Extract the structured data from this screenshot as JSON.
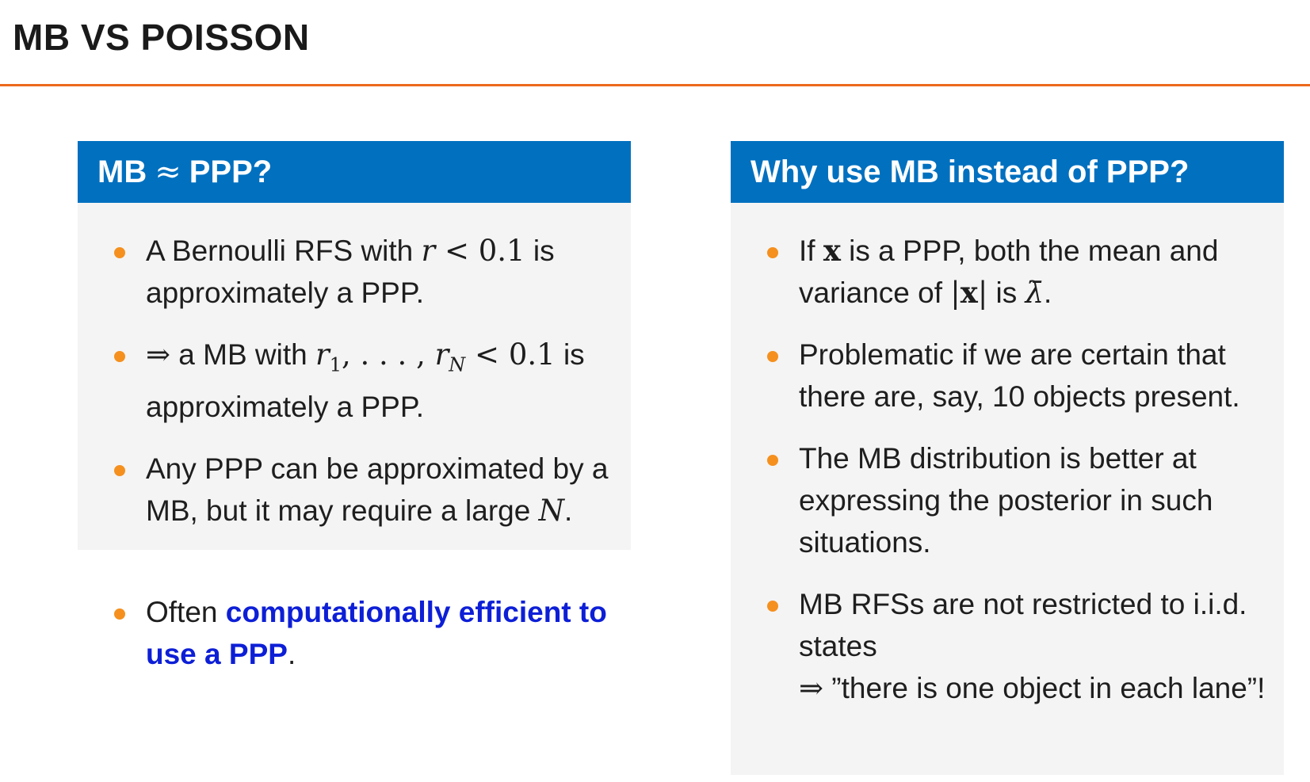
{
  "slide": {
    "title": "MB VS POISSON"
  },
  "left_block": {
    "title_pre": "MB",
    "title_symbol": "≈",
    "title_post": "PPP?",
    "items": [
      {
        "t1": "A Bernoulli RFS with ",
        "m1": "r",
        "m2": " < 0.1",
        "t2": " is approximately a PPP."
      },
      {
        "m1": "⇒",
        "t1": " a MB with ",
        "m2": "r",
        "sub1": "1",
        "m3": ", . . . , ",
        "m4": "r",
        "sub2": "N",
        "m5": " < 0.1",
        "t2": " is approximately a PPP."
      },
      {
        "t1": "Any PPP can be approximated by a MB, but it may require a large ",
        "m1": "N",
        "t2": "."
      }
    ]
  },
  "loose_item": {
    "t1": "Often ",
    "highlight": "computationally efficient to use a PPP",
    "t2": "."
  },
  "right_block": {
    "title": "Why use MB instead of PPP?",
    "items": [
      {
        "t1": "If ",
        "m1": "x",
        "t2": " is a PPP, both the mean and variance of ",
        "m2": "|",
        "m3": "x",
        "m4": "|",
        "t3": " is ",
        "m5": "λ̄",
        "t4": "."
      },
      {
        "t1": "Problematic if we are certain that there are, say, 10 objects present."
      },
      {
        "t1": "The MB distribution is better at expressing the posterior in such situations."
      },
      {
        "t1": "MB RFSs are not restricted to i.i.d. states",
        "m1": "⇒",
        "t2": " ”there is one object in each lane”!"
      }
    ]
  },
  "colors": {
    "accent_rule": "#ec6a1c",
    "block_header": "#0070bf",
    "block_body": "#f4f4f4",
    "bullet": "#f5901e",
    "highlight": "#0d1fd6"
  }
}
